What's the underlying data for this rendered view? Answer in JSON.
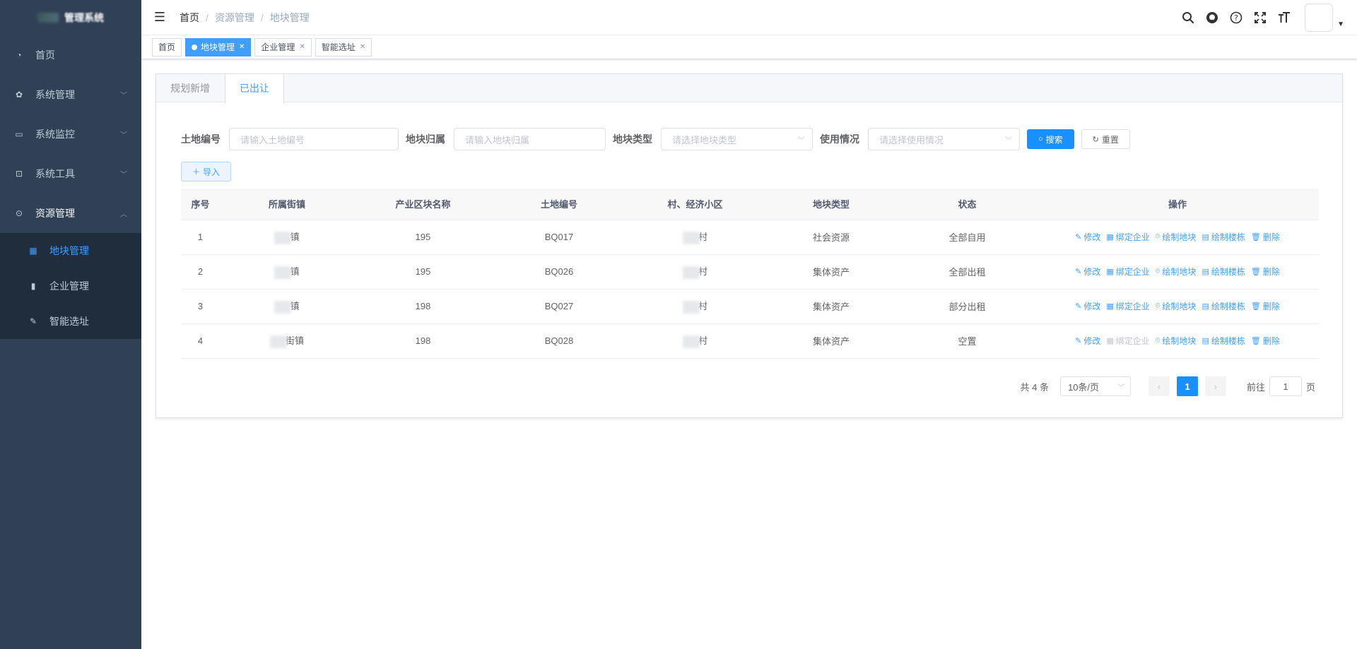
{
  "sidebar": {
    "logo_text": "管理系统",
    "items": [
      {
        "label": "首页",
        "icon": "dashboard-icon"
      },
      {
        "label": "系统管理",
        "icon": "gear-icon"
      },
      {
        "label": "系统监控",
        "icon": "monitor-icon"
      },
      {
        "label": "系统工具",
        "icon": "toolbox-icon"
      },
      {
        "label": "资源管理",
        "icon": "resource-icon"
      }
    ],
    "sub_items": [
      {
        "label": "地块管理",
        "icon": "grid-icon"
      },
      {
        "label": "企业管理",
        "icon": "bar-chart-icon"
      },
      {
        "label": "智能选址",
        "icon": "edit-icon"
      }
    ]
  },
  "navbar": {
    "breadcrumb": [
      "首页",
      "资源管理",
      "地块管理"
    ],
    "separator": "/"
  },
  "tags": [
    "首页",
    "地块管理",
    "企业管理",
    "智能选址"
  ],
  "tabs": [
    "规划新增",
    "已出让"
  ],
  "search": {
    "land_no_label": "土地编号",
    "land_no_placeholder": "请输入土地编号",
    "owner_label": "地块归属",
    "owner_placeholder": "请输入地块归属",
    "type_label": "地块类型",
    "type_placeholder": "请选择地块类型",
    "usage_label": "使用情况",
    "usage_placeholder": "请选择使用情况",
    "search_btn": "搜索",
    "reset_btn": "重置",
    "import_btn": "导入"
  },
  "table": {
    "headers": [
      "序号",
      "所属街镇",
      "产业区块名称",
      "土地编号",
      "村、经济小区",
      "地块类型",
      "状态",
      "操作"
    ],
    "rows": [
      {
        "no": "1",
        "town": "镇",
        "block": "195",
        "land_no": "BQ017",
        "village": "村",
        "type": "社会资源",
        "status": "全部自用",
        "bind_disabled": false
      },
      {
        "no": "2",
        "town": "镇",
        "block": "195",
        "land_no": "BQ026",
        "village": "村",
        "type": "集体资产",
        "status": "全部出租",
        "bind_disabled": false
      },
      {
        "no": "3",
        "town": "镇",
        "block": "198",
        "land_no": "BQ027",
        "village": "村",
        "type": "集体资产",
        "status": "部分出租",
        "bind_disabled": false
      },
      {
        "no": "4",
        "town": "街镇",
        "block": "198",
        "land_no": "BQ028",
        "village": "村",
        "type": "集体资产",
        "status": "空置",
        "bind_disabled": true
      }
    ],
    "ops": {
      "edit": "修改",
      "bind": "绑定企业",
      "draw_plot": "绘制地块",
      "draw_building": "绘制楼栋",
      "delete": "删除"
    }
  },
  "pagination": {
    "total": "共 4 条",
    "page_size": "10条/页",
    "current": "1",
    "goto_prefix": "前往",
    "goto_value": "1",
    "goto_suffix": "页"
  }
}
